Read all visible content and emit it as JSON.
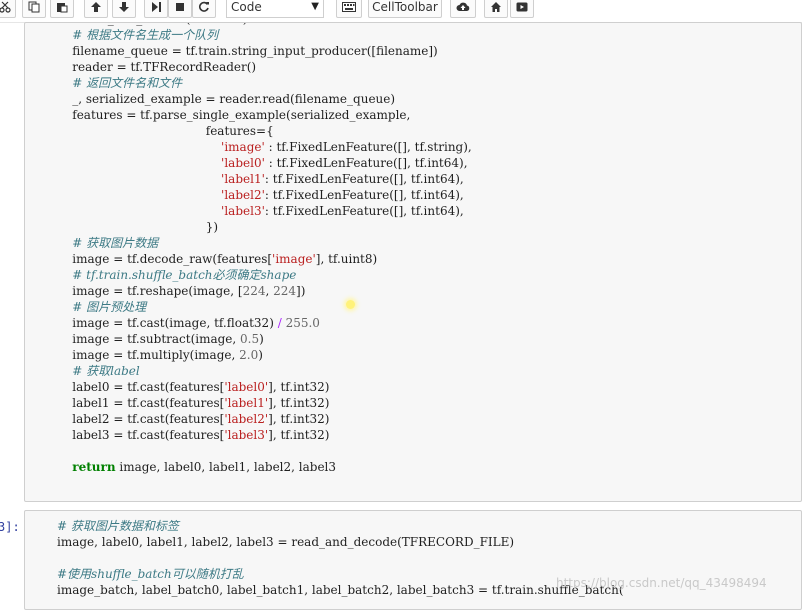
{
  "toolbar": {
    "cell_type_value": "Code",
    "celltoolbar_label": "CellToolbar",
    "icons": [
      "cut-icon",
      "copy-icon",
      "paste-icon",
      "move-up-icon",
      "move-down-icon",
      "run-icon",
      "stop-icon",
      "restart-icon",
      "keyboard-icon",
      "upload-icon",
      "home-icon",
      "present-icon"
    ]
  },
  "cell1": {
    "lines": [
      [
        {
          "t": "def read_and_decode(filename):",
          "k": ""
        }
      ],
      [
        {
          "t": "    # 根据文件名生成一个队列",
          "k": "c"
        }
      ],
      [
        {
          "t": "    filename_queue = tf.train.string_input_producer([filename])",
          "k": ""
        }
      ],
      [
        {
          "t": "    reader = tf.TFRecordReader()",
          "k": ""
        }
      ],
      [
        {
          "t": "    # 返回文件名和文件",
          "k": "c"
        }
      ],
      [
        {
          "t": "    _, serialized_example = reader.read(filename_queue)",
          "k": ""
        }
      ],
      [
        {
          "t": "    features = tf.parse_single_example(serialized_example,",
          "k": ""
        }
      ],
      [
        {
          "t": "                                       features={",
          "k": ""
        }
      ],
      [
        {
          "t": "                                           ",
          "k": ""
        },
        {
          "t": "'image'",
          "k": "s"
        },
        {
          "t": " : tf.FixedLenFeature([], tf.string),",
          "k": ""
        }
      ],
      [
        {
          "t": "                                           ",
          "k": ""
        },
        {
          "t": "'label0'",
          "k": "s"
        },
        {
          "t": " : tf.FixedLenFeature([], tf.int64),",
          "k": ""
        }
      ],
      [
        {
          "t": "                                           ",
          "k": ""
        },
        {
          "t": "'label1'",
          "k": "s"
        },
        {
          "t": ": tf.FixedLenFeature([], tf.int64),",
          "k": ""
        }
      ],
      [
        {
          "t": "                                           ",
          "k": ""
        },
        {
          "t": "'label2'",
          "k": "s"
        },
        {
          "t": ": tf.FixedLenFeature([], tf.int64),",
          "k": ""
        }
      ],
      [
        {
          "t": "                                           ",
          "k": ""
        },
        {
          "t": "'label3'",
          "k": "s"
        },
        {
          "t": ": tf.FixedLenFeature([], tf.int64),",
          "k": ""
        }
      ],
      [
        {
          "t": "                                       })",
          "k": ""
        }
      ],
      [
        {
          "t": "    # 获取图片数据",
          "k": "c"
        }
      ],
      [
        {
          "t": "    image = tf.decode_raw(features[",
          "k": ""
        },
        {
          "t": "'image'",
          "k": "s"
        },
        {
          "t": "], tf.uint8)",
          "k": ""
        }
      ],
      [
        {
          "t": "    # tf.train.shuffle_batch必须确定shape",
          "k": "c"
        }
      ],
      [
        {
          "t": "    image = tf.reshape(image, [",
          "k": ""
        },
        {
          "t": "224",
          "k": "n"
        },
        {
          "t": ", ",
          "k": ""
        },
        {
          "t": "224",
          "k": "n"
        },
        {
          "t": "])",
          "k": ""
        }
      ],
      [
        {
          "t": "    # 图片预处理",
          "k": "c"
        }
      ],
      [
        {
          "t": "    image = tf.cast(image, tf.float32) ",
          "k": ""
        },
        {
          "t": "/",
          "k": "o"
        },
        {
          "t": " ",
          "k": ""
        },
        {
          "t": "255.0",
          "k": "n"
        }
      ],
      [
        {
          "t": "    image = tf.subtract(image, ",
          "k": ""
        },
        {
          "t": "0.5",
          "k": "n"
        },
        {
          "t": ")",
          "k": ""
        }
      ],
      [
        {
          "t": "    image = tf.multiply(image, ",
          "k": ""
        },
        {
          "t": "2.0",
          "k": "n"
        },
        {
          "t": ")",
          "k": ""
        }
      ],
      [
        {
          "t": "    # 获取label",
          "k": "c"
        }
      ],
      [
        {
          "t": "    label0 = tf.cast(features[",
          "k": ""
        },
        {
          "t": "'label0'",
          "k": "s"
        },
        {
          "t": "], tf.int32)",
          "k": ""
        }
      ],
      [
        {
          "t": "    label1 = tf.cast(features[",
          "k": ""
        },
        {
          "t": "'label1'",
          "k": "s"
        },
        {
          "t": "], tf.int32)",
          "k": ""
        }
      ],
      [
        {
          "t": "    label2 = tf.cast(features[",
          "k": ""
        },
        {
          "t": "'label2'",
          "k": "s"
        },
        {
          "t": "], tf.int32)",
          "k": ""
        }
      ],
      [
        {
          "t": "    label3 = tf.cast(features[",
          "k": ""
        },
        {
          "t": "'label3'",
          "k": "s"
        },
        {
          "t": "], tf.int32)",
          "k": ""
        }
      ],
      [
        {
          "t": "",
          "k": ""
        }
      ],
      [
        {
          "t": "    ",
          "k": ""
        },
        {
          "t": "return",
          "k": "k"
        },
        {
          "t": " image, label0, label1, label2, label3",
          "k": ""
        }
      ]
    ]
  },
  "cell2": {
    "prompt": "3]:",
    "lines": [
      [
        {
          "t": "# 获取图片数据和标签",
          "k": "c"
        }
      ],
      [
        {
          "t": "image, label0, label1, label2, label3 = read_and_decode(TFRECORD_FILE)",
          "k": ""
        }
      ],
      [
        {
          "t": "",
          "k": ""
        }
      ],
      [
        {
          "t": "#使用shuffle_batch可以随机打乱",
          "k": "c"
        }
      ],
      [
        {
          "t": "image_batch, label_batch0, label_batch1, label_batch2, label_batch3 = tf.train.shuffle_batch(",
          "k": ""
        }
      ]
    ]
  },
  "watermark": "https://blog.csdn.net/qq_43498494",
  "colors": {
    "comment": "#3d7a85",
    "string": "#ba2121",
    "number": "#666666",
    "keyword": "#008000",
    "operator": "#aa22ff",
    "cell_background": "#f7f7f7",
    "prompt": "#303f9f"
  }
}
